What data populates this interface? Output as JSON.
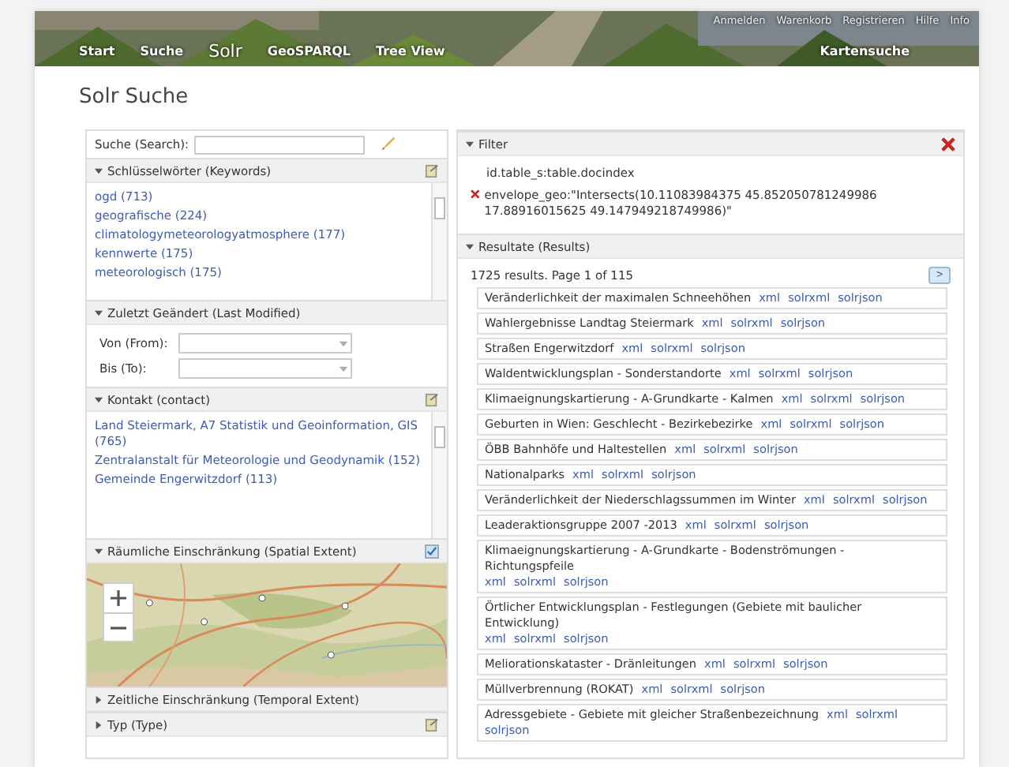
{
  "header": {
    "top_links": [
      "Anmelden",
      "Warenkorb",
      "Registrieren",
      "Hilfe",
      "Info"
    ],
    "nav": [
      {
        "label": "Start",
        "selected": false
      },
      {
        "label": "Suche",
        "selected": false
      },
      {
        "label": "Solr",
        "selected": true
      },
      {
        "label": "GeoSPARQL",
        "selected": false
      },
      {
        "label": "Tree View",
        "selected": false
      }
    ],
    "map_search": "Kartensuche"
  },
  "page_title": "Solr Suche",
  "sidebar": {
    "search": {
      "label": "Suche (Search):"
    },
    "sections": [
      {
        "kind": "list",
        "title": "Schlüsselwörter (Keywords)",
        "expanded": true,
        "items": [
          "ogd (713)",
          "geografische (224)",
          "climatologymeteorologyatmosphere (177)",
          "kennwerte (175)",
          "meteorologisch (175)"
        ]
      },
      {
        "kind": "dates",
        "title": "Zuletzt Geändert (Last Modified)",
        "expanded": true,
        "fields": [
          "Von (From):",
          "Bis (To):"
        ]
      },
      {
        "kind": "list",
        "title": "Kontakt (contact)",
        "expanded": true,
        "items": [
          "Land Steiermark, A7 Statistik und Geoinformation, GIS (765)",
          "Zentralanstalt für Meteorologie und Geodynamik (152)",
          "Gemeinde Engerwitzdorf (113)"
        ]
      },
      {
        "kind": "map",
        "title": "Räumliche Einschränkung (Spatial Extent)",
        "expanded": true,
        "checked": true
      },
      {
        "kind": "collapsed",
        "title": "Zeitliche Einschränkung (Temporal Extent)",
        "expanded": false
      },
      {
        "kind": "collapsed",
        "title": "Typ (Type)",
        "expanded": false
      }
    ]
  },
  "filter": {
    "title": "Filter",
    "expanded": true,
    "items": [
      {
        "text": "id.table_s:table.docindex",
        "removable": false
      },
      {
        "text": "envelope_geo:\"Intersects(10.11083984375 45.852050781249986 17.88916015625 49.147949218749986)\"",
        "removable": true
      }
    ]
  },
  "results": {
    "title": "Resultate (Results)",
    "expanded": true,
    "summary": "1725 results. Page 1 of 115",
    "next": ">",
    "rows": [
      {
        "title": "Veränderlichkeit der maximalen Schneehöhen",
        "links": [
          "xml",
          "solrxml",
          "solrjson"
        ]
      },
      {
        "title": "Wahlergebnisse Landtag Steiermark",
        "links": [
          "xml",
          "solrxml",
          "solrjson"
        ]
      },
      {
        "title": "Straßen Engerwitzdorf",
        "links": [
          "xml",
          "solrxml",
          "solrjson"
        ]
      },
      {
        "title": "Waldentwicklungsplan - Sonderstandorte",
        "links": [
          "xml",
          "solrxml",
          "solrjson"
        ]
      },
      {
        "title": "Klimaeignungskartierung - A-Grundkarte - Kalmen",
        "links": [
          "xml",
          "solrxml",
          "solrjson"
        ]
      },
      {
        "title": "Geburten in Wien: Geschlecht - Bezirkebezirke",
        "links": [
          "xml",
          "solrxml",
          "solrjson"
        ]
      },
      {
        "title": "ÖBB Bahnhöfe und Haltestellen",
        "links": [
          "xml",
          "solrxml",
          "solrjson"
        ]
      },
      {
        "title": "Nationalparks",
        "links": [
          "xml",
          "solrxml",
          "solrjson"
        ]
      },
      {
        "title": "Veränderlichkeit der Niederschlagssummen im Winter",
        "links": [
          "xml",
          "solrxml",
          "solrjson"
        ]
      },
      {
        "title": "Leaderaktionsgruppe 2007 -2013",
        "links": [
          "xml",
          "solrxml",
          "solrjson"
        ]
      },
      {
        "title": "Klimaeignungskartierung - A-Grundkarte - Bodenströmungen - Richtungspfeile",
        "links": [
          "xml",
          "solrxml",
          "solrjson"
        ]
      },
      {
        "title": "Örtlicher Entwicklungsplan - Festlegungen (Gebiete mit baulicher Entwicklung)",
        "links": [
          "xml",
          "solrxml",
          "solrjson"
        ]
      },
      {
        "title": "Meliorationskataster - Dränleitungen",
        "links": [
          "xml",
          "solrxml",
          "solrjson"
        ]
      },
      {
        "title": "Müllverbrennung (ROKAT)",
        "links": [
          "xml",
          "solrxml",
          "solrjson"
        ]
      },
      {
        "title": "Adressgebiete - Gebiete mit gleicher Straßenbezeichnung",
        "links": [
          "xml",
          "solrxml",
          "solrjson"
        ]
      }
    ]
  }
}
